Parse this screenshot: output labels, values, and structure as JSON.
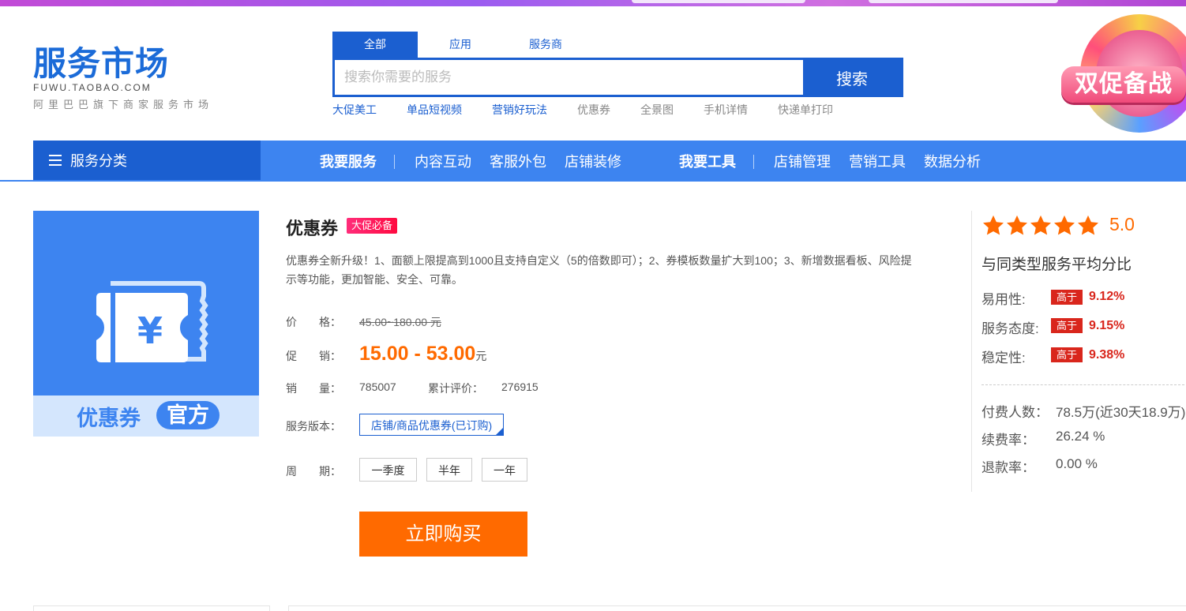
{
  "brand": {
    "title": "服务市场",
    "domain": "FUWU.TAOBAO.COM",
    "tagline": "阿里巴巴旗下商家服务市场"
  },
  "search": {
    "tabs": [
      "全部",
      "应用",
      "服务商"
    ],
    "placeholder": "搜索你需要的服务",
    "button": "搜索",
    "hot": [
      "大促美工",
      "单品短视频",
      "营销好玩法",
      "优惠券",
      "全景图",
      "手机详情",
      "快递单打印"
    ]
  },
  "promo_banner": {
    "text": "双促备战"
  },
  "nav": {
    "category": "服务分类",
    "group1_title": "我要服务",
    "group1": [
      "内容互动",
      "客服外包",
      "店铺装修"
    ],
    "group2_title": "我要工具",
    "group2": [
      "店铺管理",
      "营销工具",
      "数据分析"
    ]
  },
  "product": {
    "image_caption": "优惠券",
    "image_badge": "官方",
    "title": "优惠券",
    "badge": "大促必备",
    "description": "优惠券全新升级！1、面额上限提高到1000且支持自定义（5的倍数即可）；2、券模板数量扩大到100；3、新增数据看板、风险提示等功能，更加智能、安全、可靠。",
    "price_label": "价　　格：",
    "price": "45.00~180.00 元",
    "promo_label": "促　　销：",
    "promo_price": "15.00 - 53.00",
    "promo_unit": "元",
    "sales_label": "销　　量：",
    "sales": "785007",
    "reviews_label": "累计评价：",
    "reviews": "276915",
    "version_label": "服务版本：",
    "version": "店铺/商品优惠券(已订购)",
    "period_label": "周　　期：",
    "periods": [
      "一季度",
      "半年",
      "一年"
    ],
    "buy_button": "立即购买"
  },
  "rating": {
    "score": "5.0",
    "stars": 5,
    "compare_title": "与同类型服务平均分比",
    "metrics": [
      {
        "label": "易用性:",
        "tag": "高于",
        "value": "9.12%"
      },
      {
        "label": "服务态度:",
        "tag": "高于",
        "value": "9.15%"
      },
      {
        "label": "稳定性:",
        "tag": "高于",
        "value": "9.38%"
      }
    ],
    "stats": [
      {
        "label": "付费人数：",
        "value": "78.5万(近30天18.9万)"
      },
      {
        "label": "续费率：",
        "value": "26.24 %"
      },
      {
        "label": "退款率：",
        "value": "0.00 %"
      }
    ]
  },
  "colors": {
    "primary": "#1b5fd0",
    "nav": "#3d84f0",
    "accent": "#ff6a00",
    "red": "#d9261c"
  }
}
